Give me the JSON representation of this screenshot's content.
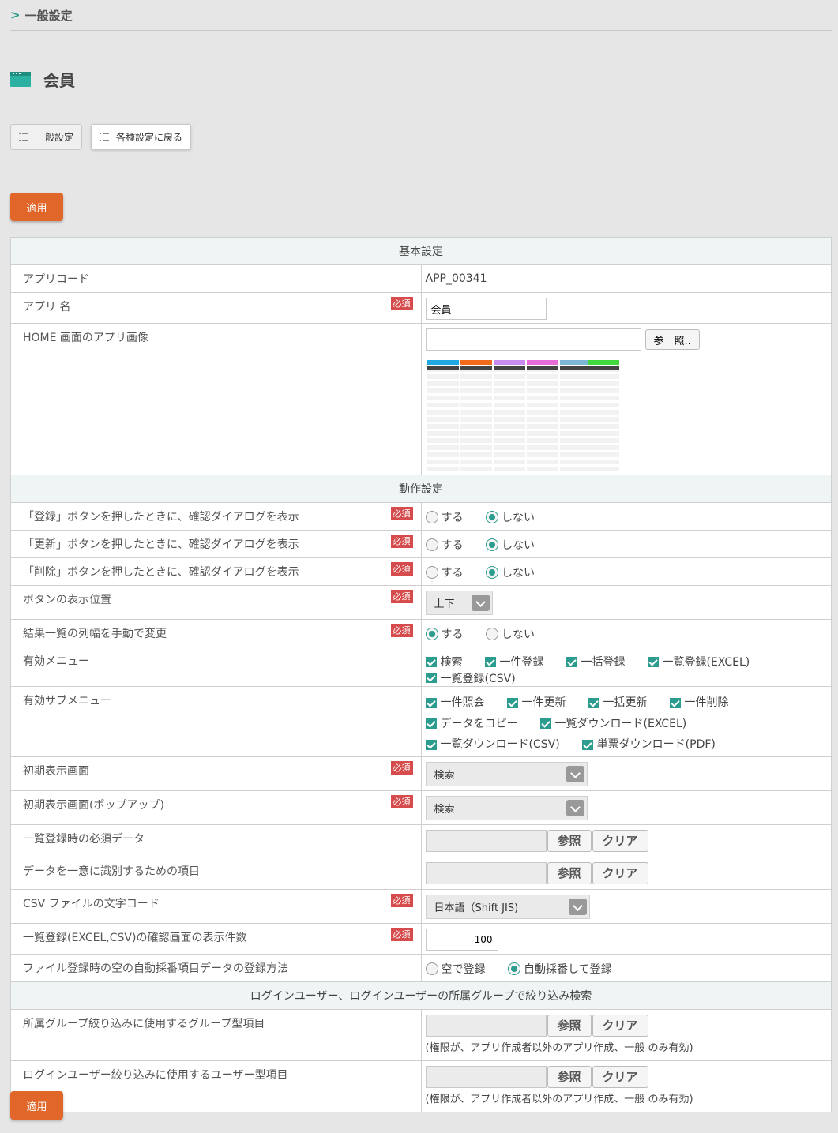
{
  "breadcrumb": "一般設定",
  "page": {
    "title": "会員"
  },
  "nav": {
    "general": "一般設定",
    "back": "各種設定に戻る"
  },
  "apply_label": "適用",
  "required_label": "必須",
  "sections": {
    "basic": "基本設定",
    "behavior": "動作設定",
    "login": "ログインユーザー、ログインユーザーの所属グループで絞り込み検索"
  },
  "rows": {
    "app_code": {
      "label": "アプリコード",
      "value": "APP_00341"
    },
    "app_name": {
      "label": "アプリ 名",
      "value": "会員"
    },
    "home_image": {
      "label": "HOME 画面のアプリ画像",
      "browse": "参　照.."
    },
    "confirm_register": {
      "label": "「登録」ボタンを押したときに、確認ダイアログを表示"
    },
    "confirm_update": {
      "label": "「更新」ボタンを押したときに、確認ダイアログを表示"
    },
    "confirm_delete": {
      "label": "「削除」ボタンを押したときに、確認ダイアログを表示"
    },
    "button_position": {
      "label": "ボタンの表示位置",
      "value": "上下"
    },
    "column_width": {
      "label": "結果一覧の列幅を手動で変更"
    },
    "menu": {
      "label": "有効メニュー",
      "items": [
        "検索",
        "一件登録",
        "一括登録",
        "一覧登録(EXCEL)",
        "一覧登録(CSV)"
      ]
    },
    "submenu": {
      "label": "有効サブメニュー",
      "items": [
        "一件照会",
        "一件更新",
        "一括更新",
        "一件削除",
        "データをコピー",
        "一覧ダウンロード(EXCEL)",
        "一覧ダウンロード(CSV)",
        "単票ダウンロード(PDF)"
      ]
    },
    "initial_screen": {
      "label": "初期表示画面",
      "value": "検索"
    },
    "initial_popup": {
      "label": "初期表示画面(ポップアップ)",
      "value": "検索"
    },
    "required_data": {
      "label": "一覧登録時の必須データ"
    },
    "unique_item": {
      "label": "データを一意に識別するための項目"
    },
    "csv_encoding": {
      "label": "CSV ファイルの文字コード",
      "value": "日本語（Shift JIS)"
    },
    "confirm_count": {
      "label": "一覧登録(EXCEL,CSV)の確認画面の表示件数",
      "value": "100"
    },
    "auto_number": {
      "label": "ファイル登録時の空の自動採番項目データの登録方法",
      "opt_empty": "空で登録",
      "opt_auto": "自動採番して登録"
    },
    "group_filter": {
      "label": "所属グループ絞り込みに使用するグループ型項目"
    },
    "user_filter": {
      "label": "ログインユーザー絞り込みに使用するユーザー型項目"
    }
  },
  "radio": {
    "yes": "する",
    "no": "しない"
  },
  "picker": {
    "browse": "参照",
    "clear": "クリア"
  },
  "permission_note": "(権限が、アプリ作成者以外のアプリ作成、一般 のみ有効)",
  "colors": {
    "accent": "#2b9c8e",
    "apply": "#e0662a",
    "required": "#d64b4b"
  }
}
